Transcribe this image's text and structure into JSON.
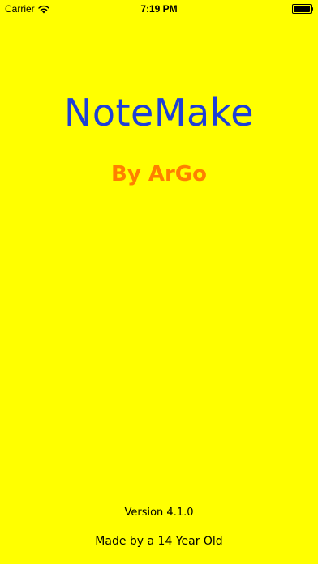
{
  "status_bar": {
    "carrier": "Carrier",
    "time": "7:19 PM",
    "battery_level": 1.0,
    "wifi_icon": "wifi-icon",
    "battery_icon": "battery-icon"
  },
  "splash": {
    "title": "NoteMake",
    "byline": "By ArGo",
    "version": "Version 4.1.0",
    "footer": "Made by a 14 Year Old"
  },
  "colors": {
    "background": "#ffff00",
    "title": "#1e3fd6",
    "byline": "#ff7f00",
    "text": "#000000"
  }
}
